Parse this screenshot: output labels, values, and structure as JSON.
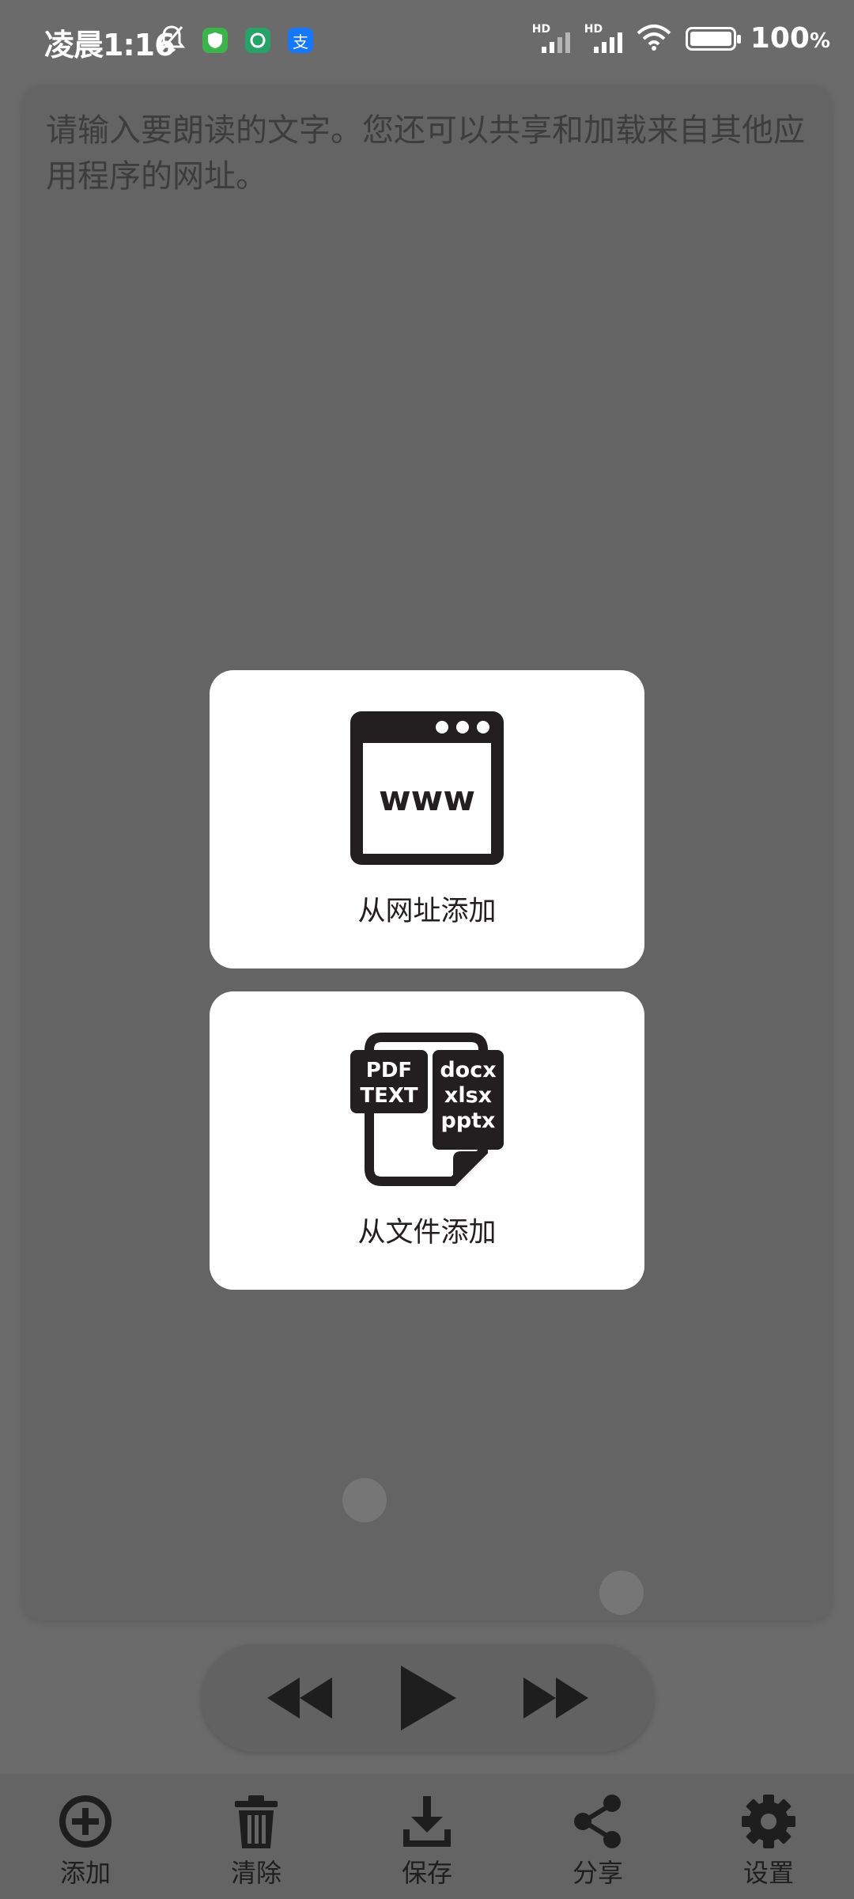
{
  "status_bar": {
    "time": "凌晨1:16",
    "battery_percent": "100",
    "battery_suffix": "%",
    "signal_label_1": "HD",
    "signal_label_2": "HD",
    "app_icon_3_glyph": "支"
  },
  "editor": {
    "placeholder": "请输入要朗读的文字。您还可以共享和加载来自其他应用程序的网址。"
  },
  "add_menu": {
    "url_option": {
      "label": "从网址添加",
      "icon_text": "www"
    },
    "file_option": {
      "label": "从文件添加",
      "icon_text_left_1": "PDF",
      "icon_text_left_2": "TEXT",
      "icon_text_right_1": "docx",
      "icon_text_right_2": "xlsx",
      "icon_text_right_3": "pptx"
    }
  },
  "bottom_nav": {
    "add": "添加",
    "clear": "清除",
    "save": "保存",
    "share": "分享",
    "settings": "设置"
  },
  "colors": {
    "overlay_bg": "#6b6b6b",
    "icon_dark": "#231f20",
    "card_bg": "#ffffff"
  }
}
